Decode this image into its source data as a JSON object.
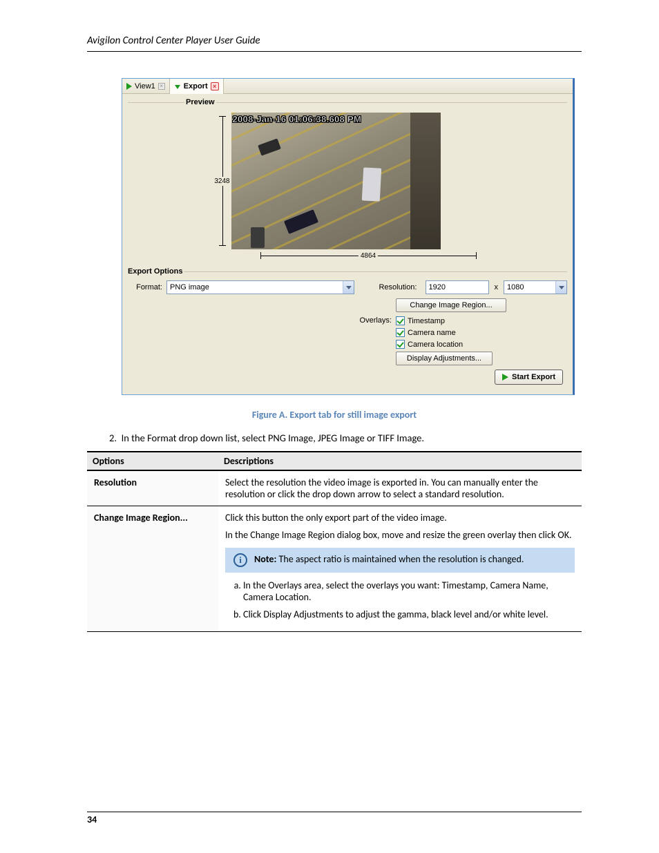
{
  "doc": {
    "header": "Avigilon Control Center Player User Guide",
    "page_number": "34",
    "figure_caption": "Figure A.    Export tab for still image export",
    "instruction": "In the Format drop down list, select PNG Image, JPEG Image or TIFF Image.",
    "table": {
      "head_opt": "Options",
      "head_desc": "Descriptions",
      "rows": [
        {
          "opt": "Resolution",
          "desc": "Select the resolution the video image is exported in. You can manually enter the resolution or click the drop down arrow to select a standard resolution."
        },
        {
          "opt": "Change Image Region...",
          "desc_intro": "Click this button the only export part of the video image.",
          "desc_dialog": "In the Change Image Region dialog box, move and resize the green overlay then click OK.",
          "note_label": "Note:",
          "note_text": "The aspect ratio is maintained when the resolution is changed.",
          "steps": [
            "In the Overlays area, select the overlays you want: Timestamp, Camera Name, Camera Location.",
            "Click Display Adjustments to adjust the gamma, black level and/or white level."
          ]
        }
      ]
    }
  },
  "app": {
    "tabs": {
      "view1": "View1",
      "export": "Export"
    },
    "preview_label": "Preview",
    "timestamp": "2008-Jan-16 01:06:38.608 PM",
    "dim_v": "3248",
    "dim_h": "4864",
    "export_options_label": "Export Options",
    "format_label": "Format:",
    "format_value": "PNG image",
    "resolution_label": "Resolution:",
    "res_w": "1920",
    "res_h": "1080",
    "res_x": "x",
    "change_region_btn": "Change Image Region...",
    "overlays_label": "Overlays:",
    "overlays": {
      "timestamp": "Timestamp",
      "camera_name": "Camera name",
      "camera_location": "Camera location"
    },
    "display_adj_btn": "Display Adjustments...",
    "start_export": "Start Export"
  }
}
